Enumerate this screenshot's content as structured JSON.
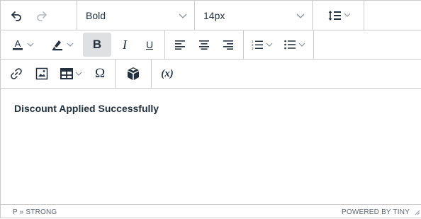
{
  "toolbar": {
    "undo_icon": "undo-icon",
    "redo_icon": "redo-icon",
    "block_format": {
      "value": "Bold"
    },
    "font_size": {
      "value": "14px"
    },
    "line_height_icon": "line-height-icon",
    "text_color_icon": "text-color-icon",
    "highlight_icon": "highlight-icon",
    "bold_label": "B",
    "italic_label": "I",
    "underline_label": "U",
    "align_left_icon": "align-left-icon",
    "align_center_icon": "align-center-icon",
    "align_right_icon": "align-right-icon",
    "numbered_list_icon": "numbered-list-icon",
    "bullet_list_icon": "bullet-list-icon",
    "link_icon": "link-icon",
    "image_icon": "image-icon",
    "table_icon": "table-icon",
    "special_char_label": "Ω",
    "plugin_icon": "cube-icon",
    "variable_label": "(x)"
  },
  "content": {
    "text": "Discount Applied Successfully"
  },
  "statusbar": {
    "path": "P » STRONG",
    "branding": "POWERED BY TINY"
  },
  "colors": {
    "border": "#cccccc",
    "text": "#222f3e",
    "active_bg": "#dee0e2",
    "muted": "#8a939c"
  }
}
